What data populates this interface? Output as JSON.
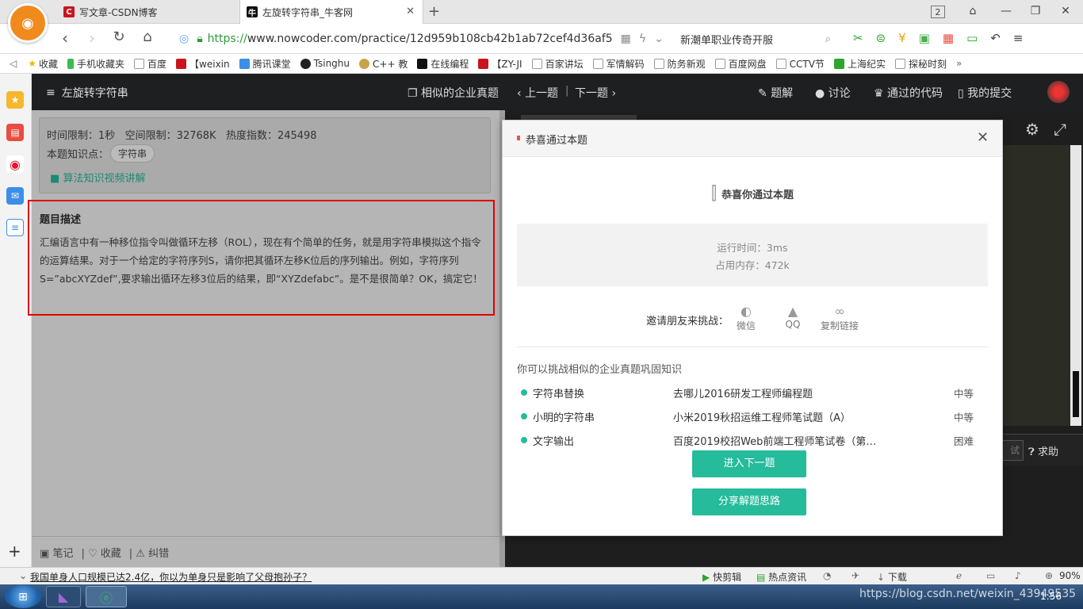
{
  "browser": {
    "tabs": [
      {
        "label": "写文章-CSDN博客",
        "icon": "C"
      },
      {
        "label": "左旋转字符串_牛客网",
        "icon": "牛"
      }
    ],
    "tab_count": "2",
    "url_scheme": "https://",
    "url_rest": "www.nowcoder.com/practice/12d959b108cb42b1ab72cef4d36af5",
    "search_text": "新潮单职业传奇开服",
    "bookmarks": [
      "收藏",
      "手机收藏夹",
      "百度",
      "【weixin",
      "腾讯课堂",
      "Tsinghu",
      "C++ 教",
      "在线编程",
      "【ZY-JI",
      "百家讲坛",
      "军情解码",
      "防务新观",
      "百度网盘",
      "CCTV节",
      "上海纪实",
      "探秘时刻"
    ],
    "colors": {
      "csdn": "#c9151e",
      "accent": "#25bb9b",
      "highlight": "#e00000"
    }
  },
  "page": {
    "title": "左旋转字符串",
    "similar_link": "相似的企业真题",
    "prev": "上一题",
    "next": "下一题",
    "nav": [
      "题解",
      "讨论",
      "通过的代码",
      "我的提交"
    ],
    "info_line": "时间限制：1秒   空间限制：32768K   热度指数：245498",
    "knowledge_label": "本题知识点：",
    "knowledge_tag": "字符串",
    "video_link": "算法知识视频讲解",
    "desc_title": "题目描述",
    "desc_lines": [
      "汇编语言中有一种移位指令叫做循环左移（ROL），现在有个简单的任务，就是用字符串模拟这个指令",
      "的运算结果。对于一个给定的字符序列S，请你把其循环左移K位后的序列输出。例如，字符序列",
      "S=”abcXYZdef”,要求输出循环左移3位后的结果，即“XYZdefabc”。是不是很简单？OK，搞定它！"
    ],
    "footer": [
      "笔记",
      "收藏",
      "纠错"
    ],
    "right_partial": "试",
    "help": "求助"
  },
  "modal": {
    "header": "恭喜通过本题",
    "congrats": "恭喜你通过本题",
    "runtime": "运行时间：3ms",
    "memory": "占用内存：472k",
    "invite_label": "邀请朋友来挑战：",
    "share": [
      "微信",
      "QQ",
      "复制链接"
    ],
    "similar_title": "你可以挑战相似的企业真题巩固知识",
    "similar": [
      {
        "name": "字符串替换",
        "source": "去哪儿2016研发工程师编程题",
        "level": "中等"
      },
      {
        "name": "小明的字符串",
        "source": "小米2019秋招运维工程师笔试题（A）",
        "level": "中等"
      },
      {
        "name": "文字输出",
        "source": "百度2019校招Web前端工程师笔试卷（第…",
        "level": "困难"
      }
    ],
    "next_button": "进入下一题",
    "share_button": "分享解题思路"
  },
  "status": {
    "news": "我国单身人口规模已达2.4亿，你以为单身只是影响了父母抱孙子？",
    "items": [
      "快剪辑",
      "热点资讯",
      "下载"
    ],
    "zoom": "90%"
  },
  "taskbar": {
    "watermark": "https://blog.csdn.net/weixin_43949535",
    "clock": "1:56"
  }
}
